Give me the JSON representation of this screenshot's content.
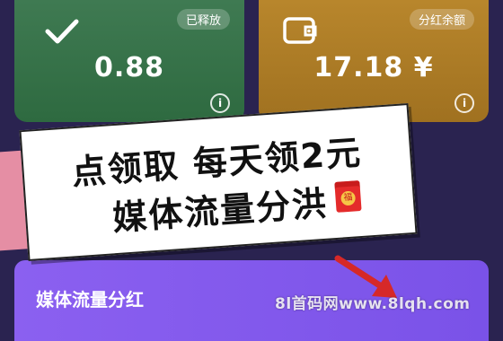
{
  "cards": {
    "released": {
      "badge": "已释放",
      "value": "0.88",
      "icon": "check-icon",
      "color": "#3f7a52"
    },
    "dividend": {
      "badge": "分红余额",
      "value": "17.18 ¥",
      "icon": "wallet-icon",
      "color": "#b8862c"
    }
  },
  "banner": {
    "line1": "点领取 每天领2元",
    "line2": "媒体流量分洪",
    "envelope_char": "福"
  },
  "section": {
    "title": "媒体流量分红",
    "color": "#8b60f0"
  },
  "watermark": "8l首码网www.8lqh.com"
}
